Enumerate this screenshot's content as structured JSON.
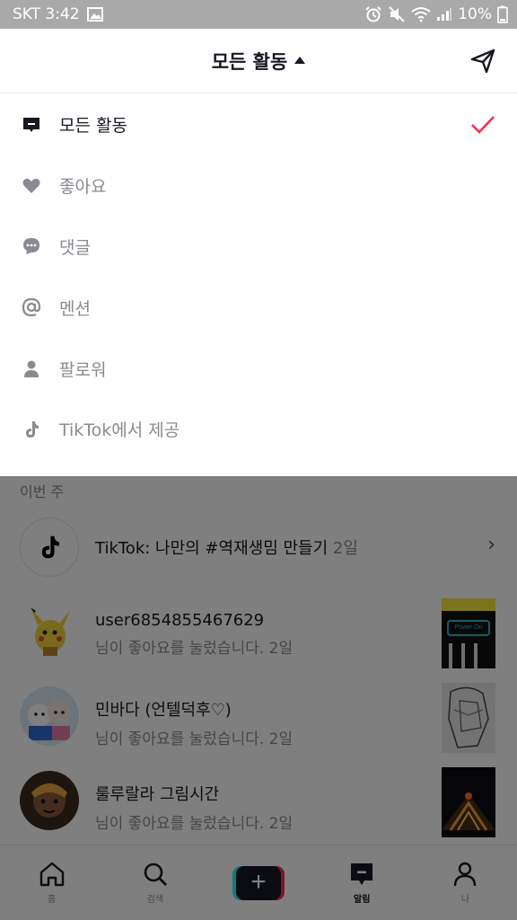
{
  "status_bar": {
    "carrier_time": "SKT 3:42",
    "battery": "10%"
  },
  "header": {
    "title": "모든 활동",
    "send_icon": "paper-plane-icon"
  },
  "menu": {
    "items": [
      {
        "label": "모든 활동",
        "icon": "message-square-icon",
        "selected": true
      },
      {
        "label": "좋아요",
        "icon": "heart-icon",
        "selected": false
      },
      {
        "label": "댓글",
        "icon": "comment-bubble-icon",
        "selected": false
      },
      {
        "label": "멘션",
        "icon": "at-sign-icon",
        "selected": false
      },
      {
        "label": "팔로워",
        "icon": "person-icon",
        "selected": false
      },
      {
        "label": "TikTok에서 제공",
        "icon": "tiktok-logo-icon",
        "selected": false
      }
    ]
  },
  "feed": {
    "section_label": "이번 주",
    "rows": [
      {
        "name": "TikTok: 나만의 #역재생밈 만들기",
        "time": "2일",
        "sub": ""
      },
      {
        "name": "user6854855467629",
        "sub": "님이 좋아요를 눌렀습니다. 2일"
      },
      {
        "name": "민바다  (언텔덕후♡)",
        "sub": "님이 좋아요를 눌렀습니다. 2일"
      },
      {
        "name": "룰루랄라 그림시간",
        "sub": "님이 좋아요를 눌렀습니다. 2일"
      }
    ],
    "thumb_text": "Power On"
  },
  "bottom_nav": {
    "items": [
      {
        "label": "홈",
        "icon": "home-icon"
      },
      {
        "label": "검색",
        "icon": "search-icon"
      },
      {
        "label": "",
        "icon": "create-plus-icon"
      },
      {
        "label": "알림",
        "icon": "inbox-icon",
        "active": true
      },
      {
        "label": "나",
        "icon": "profile-icon"
      }
    ]
  },
  "colors": {
    "accent": "#fe2c55",
    "text_primary": "#161823",
    "text_secondary": "#8a8b91"
  }
}
